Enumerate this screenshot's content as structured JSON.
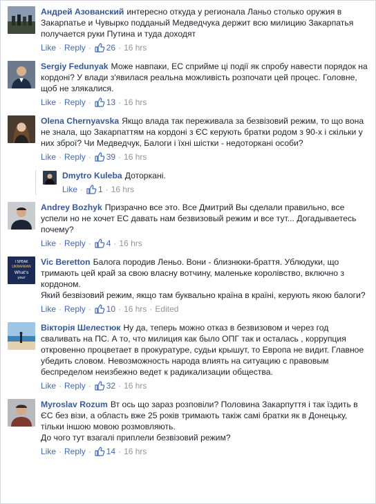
{
  "labels": {
    "like": "Like",
    "reply": "Reply",
    "separator": "·"
  },
  "accent_color": "#365899",
  "comments": [
    {
      "author": "Андрей Азованский",
      "text": "интересно откуда у регионала Ланьо столько оружия в Закарпатье и Чувырко подданый Медведчука держит всю милицию Закарпатья получается руки Путина и туда доходят",
      "likes": "26",
      "time": "16 hrs"
    },
    {
      "author": "Sergiy Fedunyak",
      "text": "Може навпаки, ЕС сприйме ці події як спробу навести порядок на кордоні? У влади з'явилася реальна можливість розпочати цей процес. Головне, щоб не злякалися.",
      "likes": "13",
      "time": "16 hrs"
    },
    {
      "author": "Olena Chernyavska",
      "text": "Якщо влада так переживала за безвізовий режим, то що вона не знала, що Закарпаттям на кордоні з ЄС керують братки родом з 90-х і скільки у них зброї? Чи Медведчук, Балоги і їхні шістки - недоторкані особи?",
      "likes": "39",
      "time": "16 hrs"
    },
    {
      "author": "Dmytro Kuleba",
      "text": "Доторкані.",
      "likes": "1",
      "time": "16 hrs"
    },
    {
      "author": "Andrey Bozhyk",
      "text": "Призрачно все это. Все Дмитрий Вы сделали правильно, все успели но не хочет ЕС давать нам безвизовый режим и все тут... Догадываетесь почему?",
      "likes": "4",
      "time": "16 hrs"
    },
    {
      "author": "Vic Beretton",
      "text": "Балога породив Леньо. Вони - близнюки-браття. Ублюдуки, що тримають цей край за свою власну вотчину, маленьке королівство, включно з кордоном.",
      "text2": "Який безвізовий режим, якщо там буквально країна в країні, керують якою балоги?",
      "likes": "10",
      "time": "16 hrs",
      "edited": "Edited",
      "avatar_text": [
        "I SPEAK",
        "UKRAINIAN",
        "What's",
        "your"
      ]
    },
    {
      "author": "Вікторія Шелестюк",
      "text": "Ну да, теперь можно отказ в безвизовом и через год сваливать на ПС. А то, что милиция как было ОПГ так и осталась , коррупция откровенно процветает в прокуратуре, судьи крышут, то Европа не видит. Главное убедить словом. Невозможность народа влиять на ситуацию с правовым беспределом неизбежно ведет к радикализации общества.",
      "likes": "32",
      "time": "16 hrs"
    },
    {
      "author": "Myroslav Rozum",
      "text": "Вт ось що зараз розповіли? Половина Закарпуття і так їздить в ЄС без візи, а область вже 25 років тримають такіж самі братки як в Донецьку, тільки іншою мовою розмовляють.",
      "text2": "До чого тут взагалі приплели безвізовий режим?",
      "likes": "14",
      "time": "16 hrs"
    }
  ]
}
